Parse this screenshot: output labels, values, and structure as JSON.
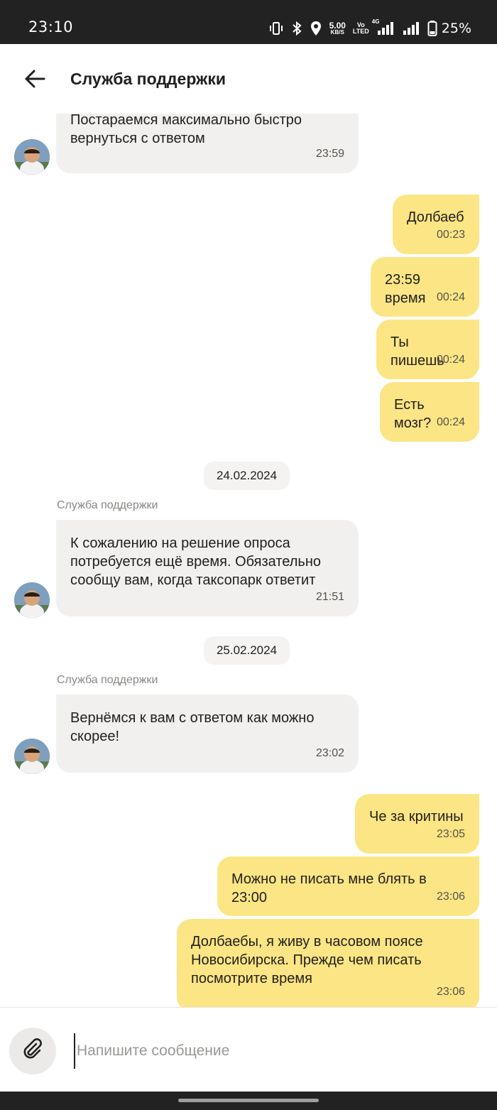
{
  "status_bar": {
    "time": "23:10",
    "net_speed_value": "5.00",
    "net_speed_unit": "KB/S",
    "volte_top": "Vo",
    "volte_bottom": "LTED",
    "network_type": "4G",
    "battery_percent": "25%",
    "icons": [
      "vibrate-icon",
      "bluetooth-icon",
      "location-icon",
      "signal-4g-icon",
      "signal-icon",
      "battery-icon"
    ]
  },
  "header": {
    "title": "Служба поддержки",
    "back_icon": "arrow-left-icon"
  },
  "colors": {
    "incoming_bubble": "#f1f0ee",
    "outgoing_bubble": "#fce584",
    "status_bar": "#222222",
    "date_chip": "#f4f3f1"
  },
  "messages": [
    {
      "direction": "in",
      "text": "Постараемся максимально быстро\nвернуться с ответом",
      "time": "23:59"
    },
    {
      "direction": "out",
      "text": "Долбаеб",
      "time": "00:23"
    },
    {
      "direction": "out",
      "text": "23:59 время",
      "time": "00:24"
    },
    {
      "direction": "out",
      "text": "Ты пишешь",
      "time": "00:24"
    },
    {
      "direction": "out",
      "text": "Есть мозг?",
      "time": "00:24"
    },
    {
      "direction": "in",
      "sender": "Служба поддержки",
      "text": "К сожалению на решение опроса\nпотребуется ещё время. Обязательно\nсообщу вам, когда таксопарк ответит",
      "time": "21:51"
    },
    {
      "direction": "in",
      "sender": "Служба поддержки",
      "text": "Вернёмся к вам с ответом как можно\nскорее!",
      "time": "23:02"
    },
    {
      "direction": "out",
      "text": "Че за критины",
      "time": "23:05"
    },
    {
      "direction": "out",
      "text": "Можно не писать мне блять в 23:00",
      "time": "23:06"
    },
    {
      "direction": "out",
      "text": "Долбаебы, я живу в часовом поясе\nНовосибирска. Прежде чем писать\nпосмотрите время",
      "time": "23:06"
    }
  ],
  "date_separators": [
    "24.02.2024",
    "25.02.2024"
  ],
  "composer": {
    "placeholder": "Напишите сообщение",
    "attach_icon": "paperclip-icon"
  }
}
